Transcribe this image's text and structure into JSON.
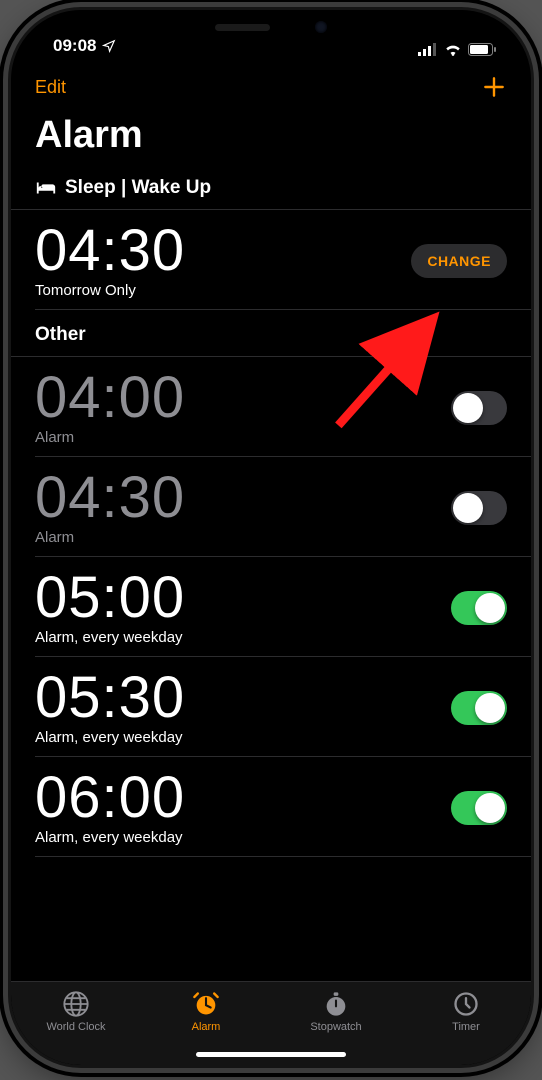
{
  "status": {
    "time": "09:08"
  },
  "nav": {
    "edit": "Edit"
  },
  "page_title": "Alarm",
  "sleep_section": {
    "label": "Sleep | Wake Up"
  },
  "sleep_alarm": {
    "time": "04:30",
    "subtitle": "Tomorrow Only",
    "change_label": "CHANGE"
  },
  "other_section": {
    "label": "Other"
  },
  "alarms": [
    {
      "time": "04:00",
      "subtitle": "Alarm",
      "enabled": false
    },
    {
      "time": "04:30",
      "subtitle": "Alarm",
      "enabled": false
    },
    {
      "time": "05:00",
      "subtitle": "Alarm, every weekday",
      "enabled": true
    },
    {
      "time": "05:30",
      "subtitle": "Alarm, every weekday",
      "enabled": true
    },
    {
      "time": "06:00",
      "subtitle": "Alarm, every weekday",
      "enabled": true
    }
  ],
  "tabs": {
    "world_clock": "World Clock",
    "alarm": "Alarm",
    "stopwatch": "Stopwatch",
    "timer": "Timer",
    "active": "alarm"
  }
}
